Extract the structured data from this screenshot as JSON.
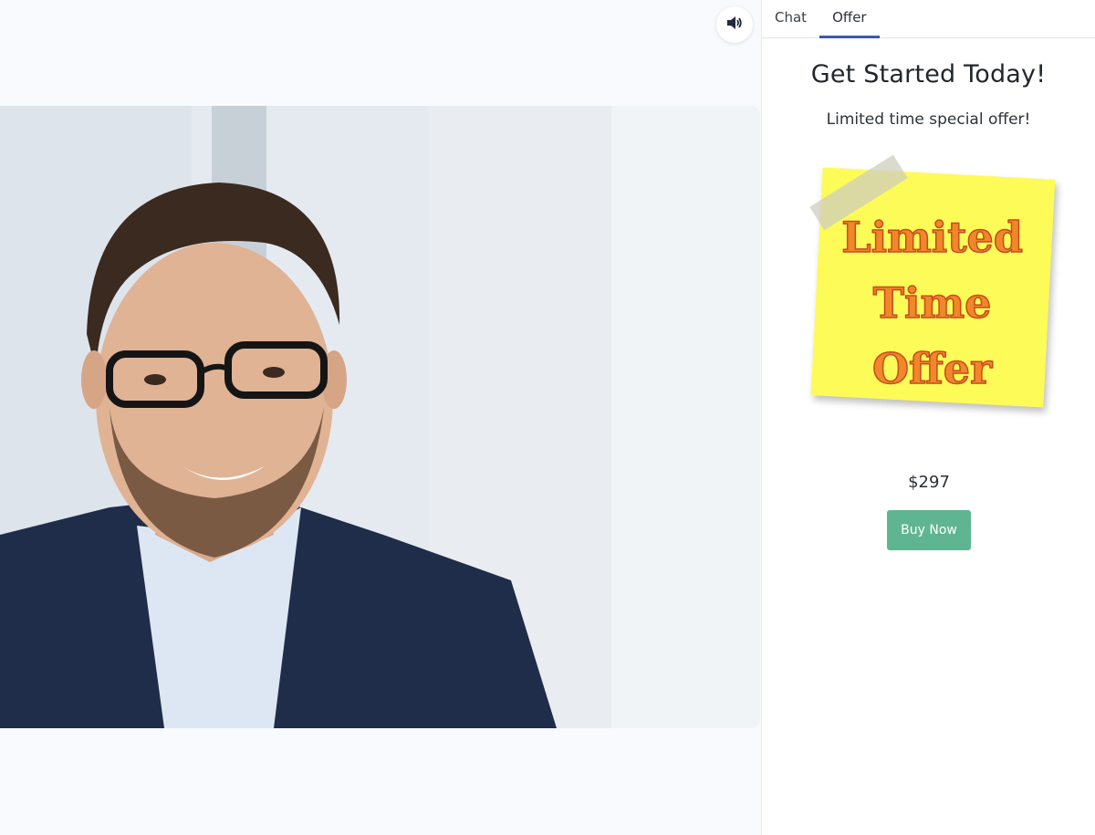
{
  "video": {
    "sound_icon": "speaker-volume-icon"
  },
  "tabs": [
    {
      "label": "Chat",
      "active": false
    },
    {
      "label": "Offer",
      "active": true
    }
  ],
  "offer": {
    "title": "Get Started Today!",
    "subtitle": "Limited time special offer!",
    "sticky_note_lines": [
      "Limited",
      "Time",
      "Offer"
    ],
    "price": "$297",
    "buy_label": "Buy Now"
  },
  "colors": {
    "accent": "#3d5aa8",
    "buy_button": "#5fb591",
    "sticky_note": "#fdfb57",
    "sticky_text": "#f0882a"
  }
}
